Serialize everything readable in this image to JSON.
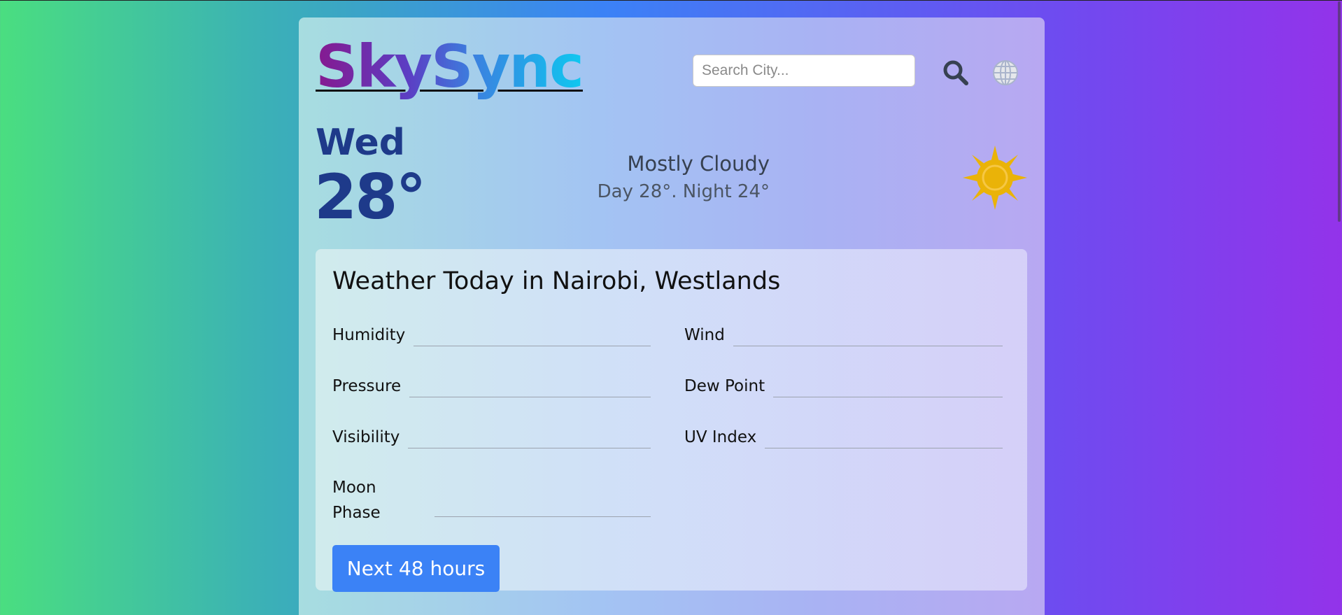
{
  "app": {
    "logo_text": "SkySync"
  },
  "search": {
    "placeholder": "Search City...",
    "value": "",
    "search_icon": "magnifier-icon",
    "globe_icon": "globe-icon"
  },
  "current": {
    "day": "Wed",
    "temperature": "28°",
    "condition": "Mostly Cloudy",
    "day_night": "Day 28°. Night 24°",
    "icon": "sun-icon"
  },
  "today": {
    "title": "Weather Today in Nairobi, Westlands",
    "metrics": {
      "humidity": {
        "label": "Humidity",
        "value": ""
      },
      "wind": {
        "label": "Wind",
        "value": ""
      },
      "pressure": {
        "label": "Pressure",
        "value": ""
      },
      "dew_point": {
        "label": "Dew Point",
        "value": ""
      },
      "visibility": {
        "label": "Visibility",
        "value": ""
      },
      "uv_index": {
        "label": "UV Index",
        "value": ""
      },
      "moon_phase": {
        "label": "Moon Phase",
        "value": ""
      }
    },
    "next_button": "Next 48 hours"
  },
  "colors": {
    "primary": "#3b82f6",
    "heading": "#1e3a8a",
    "sun": "#eab308"
  }
}
